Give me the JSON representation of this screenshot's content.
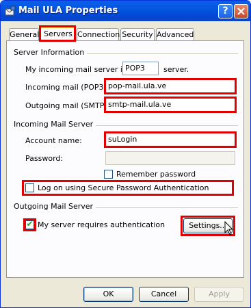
{
  "window": {
    "title": "Mail ULA Properties",
    "help_label": "?"
  },
  "tabs": [
    {
      "label": "General"
    },
    {
      "label": "Servers",
      "active": true
    },
    {
      "label": "Connection"
    },
    {
      "label": "Security"
    },
    {
      "label": "Advanced"
    }
  ],
  "server_info": {
    "heading": "Server Information",
    "incoming_type_prefix": "My incoming mail server is a",
    "incoming_type_value": "POP3",
    "incoming_type_suffix": "server.",
    "incoming_label": "Incoming mail (POP3):",
    "incoming_value": "pop-mail.ula.ve",
    "outgoing_label": "Outgoing mail (SMTP):",
    "outgoing_value": "smtp-mail.ula.ve"
  },
  "incoming_server": {
    "heading": "Incoming Mail Server",
    "account_label": "Account name:",
    "account_value": "suLogin",
    "password_label": "Password:",
    "password_value": "",
    "remember_label": "Remember password",
    "remember_checked": false,
    "spa_label": "Log on using Secure Password Authentication",
    "spa_checked": false
  },
  "outgoing_server": {
    "heading": "Outgoing Mail Server",
    "auth_label": "My server requires authentication",
    "auth_checked": true,
    "settings_label": "Settings..."
  },
  "buttons": {
    "ok": "OK",
    "cancel": "Cancel",
    "apply": "Apply"
  },
  "colors": {
    "highlight": "#e00000",
    "titlebar": "#0556e0",
    "face": "#ece9d8",
    "check": "#21a121"
  }
}
